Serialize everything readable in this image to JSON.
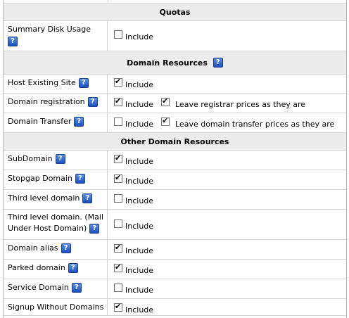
{
  "sections": {
    "quotas": "Quotas",
    "domain_resources": "Domain Resources",
    "other_domain_resources": "Other Domain Resources"
  },
  "help_glyph": "?",
  "include_label": "Include",
  "rows": {
    "summary_disk_usage": {
      "label": "Summary Disk Usage",
      "include": false
    },
    "host_existing_site": {
      "label": "Host Existing Site",
      "include": true
    },
    "domain_registration": {
      "label": "Domain registration",
      "include": true,
      "extra_label": "Leave registrar prices as they are",
      "extra_checked": true
    },
    "domain_transfer": {
      "label": "Domain Transfer",
      "include": false,
      "extra_label": "Leave domain transfer prices as they are",
      "extra_checked": true
    },
    "subdomain": {
      "label": "SubDomain",
      "include": true
    },
    "stopgap_domain": {
      "label": "Stopgap Domain",
      "include": true
    },
    "third_level_domain": {
      "label": "Third level domain",
      "include": false
    },
    "third_level_domain_mail": {
      "label_line1": "Third level domain. (Mail",
      "label_line2": "Under Host Domain)",
      "include": false
    },
    "domain_alias": {
      "label": "Domain alias",
      "include": true
    },
    "parked_domain": {
      "label": "Parked domain",
      "include": true
    },
    "service_domain": {
      "label": "Service Domain",
      "include": false
    },
    "signup_without_domains": {
      "label": "Signup Without Domains",
      "include": true
    }
  },
  "colors": {
    "header_bg": "#ececec",
    "help_icon_blue": "#1a4fc0",
    "grid_line": "#d4d4d4"
  }
}
